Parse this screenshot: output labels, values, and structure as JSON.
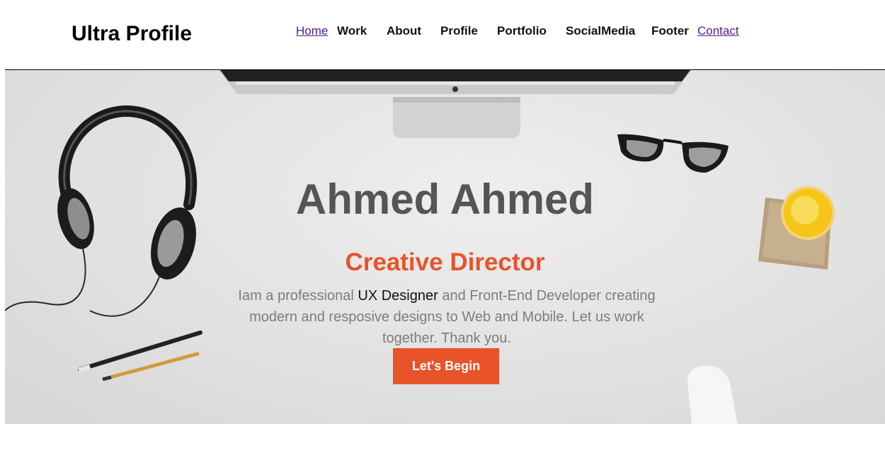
{
  "header": {
    "brand": "Ultra Profile",
    "nav": [
      {
        "label": "Home",
        "style": "link"
      },
      {
        "label": "Work",
        "style": "bold"
      },
      {
        "label": "About",
        "style": "bold"
      },
      {
        "label": "Profile",
        "style": "bold"
      },
      {
        "label": "Portfolio",
        "style": "bold"
      },
      {
        "label": "SocialMedia",
        "style": "bold"
      },
      {
        "label": "Footer",
        "style": "bold"
      },
      {
        "label": "Contact",
        "style": "link"
      }
    ]
  },
  "hero": {
    "name": "Ahmed Ahmed",
    "role": "Creative Director",
    "description_before": "Iam a professional ",
    "description_highlight": "UX Designer",
    "description_after": " and Front-End Developer creating modern and resposive designs to Web and Mobile. Let us work together. Thank you.",
    "cta_label": "Let's Begin",
    "decor_icons": [
      "headphones-icon",
      "pencils-icon",
      "imac-icon",
      "glasses-icon",
      "juice-glass-icon",
      "mouse-icon"
    ]
  },
  "colors": {
    "accent": "#e8532a",
    "name_text": "#555555",
    "body_text": "#7d7d7d",
    "visited_link": "#551a8b",
    "hero_bg": "#e4e4e4"
  }
}
